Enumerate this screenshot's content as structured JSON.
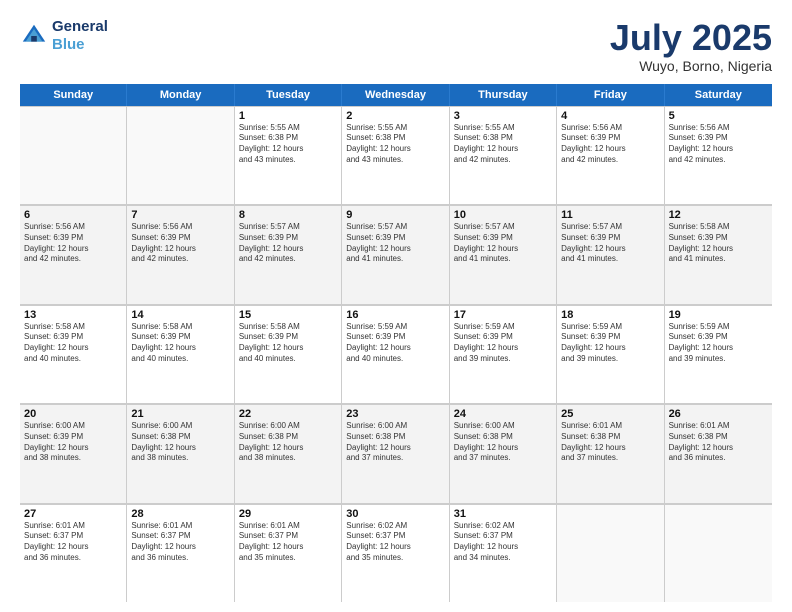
{
  "logo": {
    "line1": "General",
    "line2": "Blue"
  },
  "title": "July 2025",
  "subtitle": "Wuyo, Borno, Nigeria",
  "days": [
    "Sunday",
    "Monday",
    "Tuesday",
    "Wednesday",
    "Thursday",
    "Friday",
    "Saturday"
  ],
  "weeks": [
    [
      {
        "num": "",
        "detail": "",
        "empty": true
      },
      {
        "num": "",
        "detail": "",
        "empty": true
      },
      {
        "num": "1",
        "detail": "Sunrise: 5:55 AM\nSunset: 6:38 PM\nDaylight: 12 hours\nand 43 minutes."
      },
      {
        "num": "2",
        "detail": "Sunrise: 5:55 AM\nSunset: 6:38 PM\nDaylight: 12 hours\nand 43 minutes."
      },
      {
        "num": "3",
        "detail": "Sunrise: 5:55 AM\nSunset: 6:38 PM\nDaylight: 12 hours\nand 42 minutes."
      },
      {
        "num": "4",
        "detail": "Sunrise: 5:56 AM\nSunset: 6:39 PM\nDaylight: 12 hours\nand 42 minutes."
      },
      {
        "num": "5",
        "detail": "Sunrise: 5:56 AM\nSunset: 6:39 PM\nDaylight: 12 hours\nand 42 minutes."
      }
    ],
    [
      {
        "num": "6",
        "detail": "Sunrise: 5:56 AM\nSunset: 6:39 PM\nDaylight: 12 hours\nand 42 minutes."
      },
      {
        "num": "7",
        "detail": "Sunrise: 5:56 AM\nSunset: 6:39 PM\nDaylight: 12 hours\nand 42 minutes."
      },
      {
        "num": "8",
        "detail": "Sunrise: 5:57 AM\nSunset: 6:39 PM\nDaylight: 12 hours\nand 42 minutes."
      },
      {
        "num": "9",
        "detail": "Sunrise: 5:57 AM\nSunset: 6:39 PM\nDaylight: 12 hours\nand 41 minutes."
      },
      {
        "num": "10",
        "detail": "Sunrise: 5:57 AM\nSunset: 6:39 PM\nDaylight: 12 hours\nand 41 minutes."
      },
      {
        "num": "11",
        "detail": "Sunrise: 5:57 AM\nSunset: 6:39 PM\nDaylight: 12 hours\nand 41 minutes."
      },
      {
        "num": "12",
        "detail": "Sunrise: 5:58 AM\nSunset: 6:39 PM\nDaylight: 12 hours\nand 41 minutes."
      }
    ],
    [
      {
        "num": "13",
        "detail": "Sunrise: 5:58 AM\nSunset: 6:39 PM\nDaylight: 12 hours\nand 40 minutes."
      },
      {
        "num": "14",
        "detail": "Sunrise: 5:58 AM\nSunset: 6:39 PM\nDaylight: 12 hours\nand 40 minutes."
      },
      {
        "num": "15",
        "detail": "Sunrise: 5:58 AM\nSunset: 6:39 PM\nDaylight: 12 hours\nand 40 minutes."
      },
      {
        "num": "16",
        "detail": "Sunrise: 5:59 AM\nSunset: 6:39 PM\nDaylight: 12 hours\nand 40 minutes."
      },
      {
        "num": "17",
        "detail": "Sunrise: 5:59 AM\nSunset: 6:39 PM\nDaylight: 12 hours\nand 39 minutes."
      },
      {
        "num": "18",
        "detail": "Sunrise: 5:59 AM\nSunset: 6:39 PM\nDaylight: 12 hours\nand 39 minutes."
      },
      {
        "num": "19",
        "detail": "Sunrise: 5:59 AM\nSunset: 6:39 PM\nDaylight: 12 hours\nand 39 minutes."
      }
    ],
    [
      {
        "num": "20",
        "detail": "Sunrise: 6:00 AM\nSunset: 6:39 PM\nDaylight: 12 hours\nand 38 minutes."
      },
      {
        "num": "21",
        "detail": "Sunrise: 6:00 AM\nSunset: 6:38 PM\nDaylight: 12 hours\nand 38 minutes."
      },
      {
        "num": "22",
        "detail": "Sunrise: 6:00 AM\nSunset: 6:38 PM\nDaylight: 12 hours\nand 38 minutes."
      },
      {
        "num": "23",
        "detail": "Sunrise: 6:00 AM\nSunset: 6:38 PM\nDaylight: 12 hours\nand 37 minutes."
      },
      {
        "num": "24",
        "detail": "Sunrise: 6:00 AM\nSunset: 6:38 PM\nDaylight: 12 hours\nand 37 minutes."
      },
      {
        "num": "25",
        "detail": "Sunrise: 6:01 AM\nSunset: 6:38 PM\nDaylight: 12 hours\nand 37 minutes."
      },
      {
        "num": "26",
        "detail": "Sunrise: 6:01 AM\nSunset: 6:38 PM\nDaylight: 12 hours\nand 36 minutes."
      }
    ],
    [
      {
        "num": "27",
        "detail": "Sunrise: 6:01 AM\nSunset: 6:37 PM\nDaylight: 12 hours\nand 36 minutes."
      },
      {
        "num": "28",
        "detail": "Sunrise: 6:01 AM\nSunset: 6:37 PM\nDaylight: 12 hours\nand 36 minutes."
      },
      {
        "num": "29",
        "detail": "Sunrise: 6:01 AM\nSunset: 6:37 PM\nDaylight: 12 hours\nand 35 minutes."
      },
      {
        "num": "30",
        "detail": "Sunrise: 6:02 AM\nSunset: 6:37 PM\nDaylight: 12 hours\nand 35 minutes."
      },
      {
        "num": "31",
        "detail": "Sunrise: 6:02 AM\nSunset: 6:37 PM\nDaylight: 12 hours\nand 34 minutes."
      },
      {
        "num": "",
        "detail": "",
        "empty": true
      },
      {
        "num": "",
        "detail": "",
        "empty": true
      }
    ]
  ]
}
